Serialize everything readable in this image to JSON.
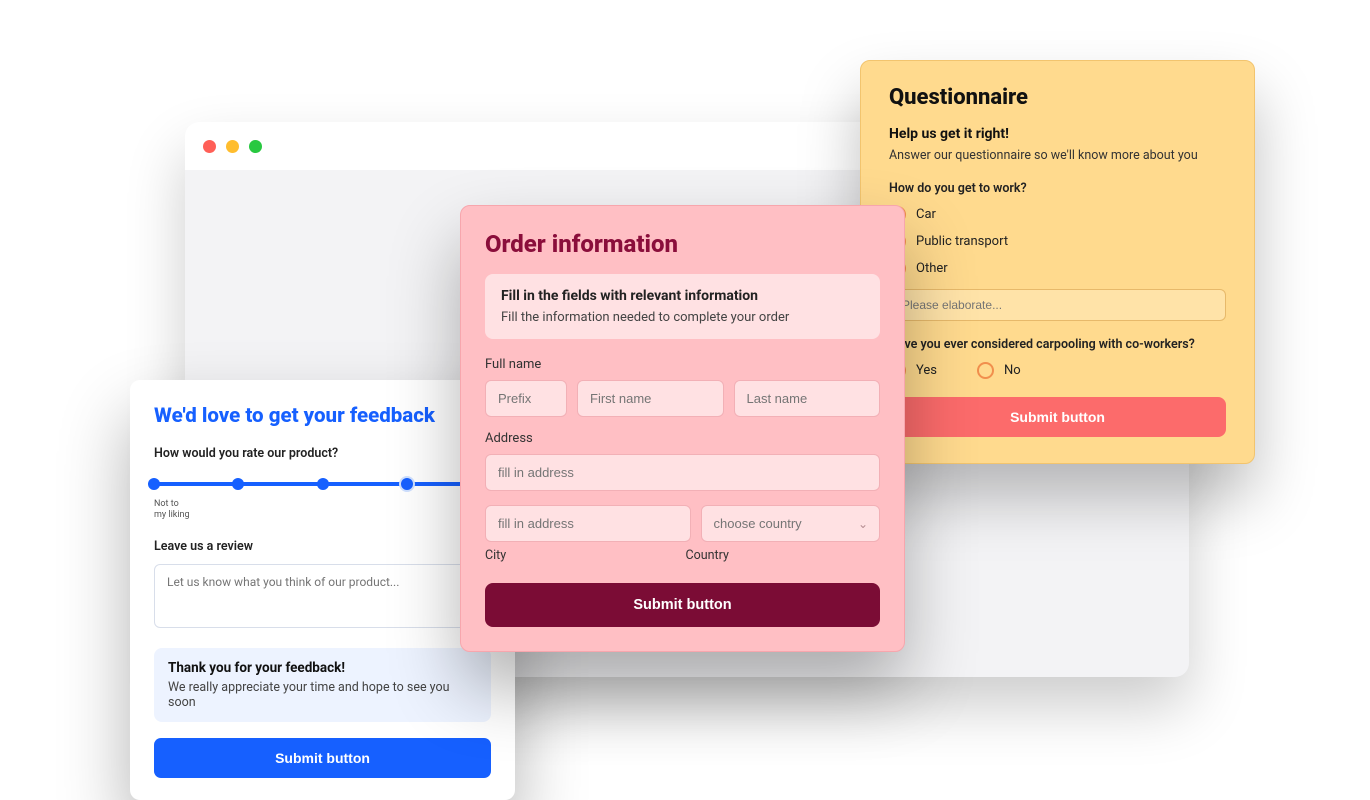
{
  "questionnaire": {
    "title": "Questionnaire",
    "subtitle": "Help us get it right!",
    "desc": "Answer our questionnaire so we'll know more about you",
    "q1": "How do you get to work?",
    "q1_options": [
      "Car",
      "Public transport",
      "Other"
    ],
    "elaborate_placeholder": "Please elaborate...",
    "q2": "Have you ever considered carpooling with co-workers?",
    "q2_options": [
      "Yes",
      "No"
    ],
    "submit": "Submit button"
  },
  "order": {
    "title": "Order information",
    "info_title": "Fill in the fields with relevant information",
    "info_desc": "Fill the information needed to complete your order",
    "fullname_label": "Full name",
    "prefix_ph": "Prefix",
    "first_ph": "First name",
    "last_ph": "Last name",
    "address_label": "Address",
    "address_ph": "fill in address",
    "address2_ph": "fill in address",
    "country_ph": "choose country",
    "city_label": "City",
    "country_label": "Country",
    "submit": "Submit button"
  },
  "feedback": {
    "title": "We'd love to get your feedback",
    "q1": "How would you rate our product?",
    "slider_low": "Not to\nmy liking",
    "review_label": "Leave us a review",
    "review_ph": "Let us know what you think of our product...",
    "thanks_title": "Thank you for your feedback!",
    "thanks_desc": "We really appreciate your time and hope to see you soon",
    "submit": "Submit button"
  }
}
